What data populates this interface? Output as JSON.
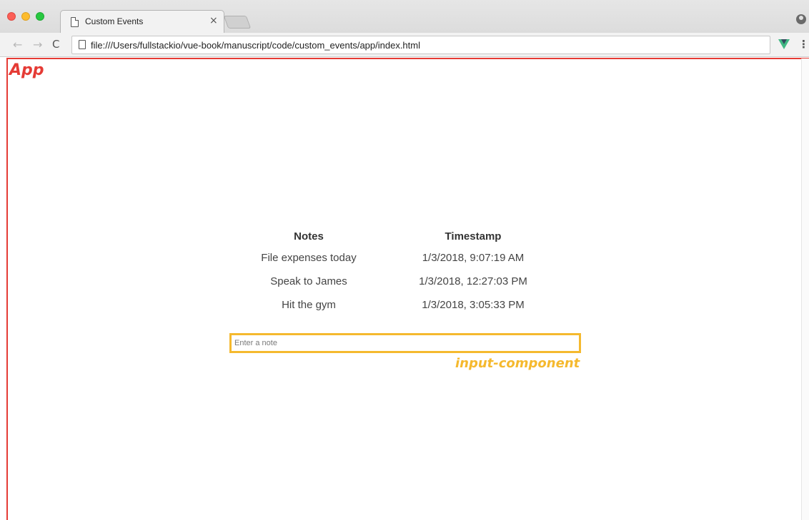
{
  "browser": {
    "tab_title": "Custom Events",
    "tab_close": "×",
    "url": "file:///Users/fullstackio/vue-book/manuscript/code/custom_events/app/index.html",
    "nav": {
      "back": "←",
      "forward": "→",
      "reload": "C"
    },
    "menu": "⋮",
    "extension": "vue-devtools-icon"
  },
  "annotations": {
    "app_label": "App",
    "input_component_label": "input-component",
    "app_color": "#e53b35",
    "input_color": "#f5b92e"
  },
  "table": {
    "headers": [
      "Notes",
      "Timestamp"
    ],
    "rows": [
      {
        "note": "File expenses today",
        "timestamp": "1/3/2018, 9:07:19 AM"
      },
      {
        "note": "Speak to James",
        "timestamp": "1/3/2018, 12:27:03 PM"
      },
      {
        "note": "Hit the gym",
        "timestamp": "1/3/2018, 3:05:33 PM"
      }
    ]
  },
  "input": {
    "placeholder": "Enter a note",
    "value": ""
  }
}
